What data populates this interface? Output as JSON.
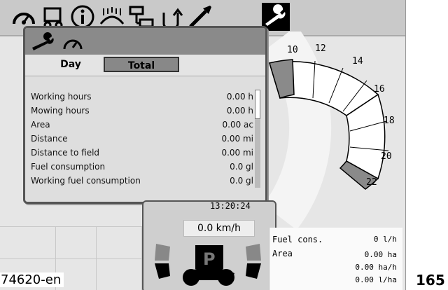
{
  "toolbar": {
    "icons": [
      "speedometer-icon",
      "machine-icon",
      "info-icon",
      "mower-icon",
      "transmission-icon",
      "reverse-icon",
      "wrench-icon",
      "settings-wrench-icon"
    ],
    "active_index": 7
  },
  "gauge": {
    "labels": [
      "10",
      "12",
      "14",
      "16",
      "18",
      "20",
      "22"
    ]
  },
  "counter_panel": {
    "tabs": {
      "day": "Day",
      "total": "Total"
    },
    "active_tab": "Total",
    "rows": [
      {
        "label": "Working hours",
        "value": "0.00 h"
      },
      {
        "label": "Mowing hours",
        "value": "0.00 h"
      },
      {
        "label": "Area",
        "value": "0.00 ac"
      },
      {
        "label": "Distance",
        "value": "0.00 mi"
      },
      {
        "label": "Distance to field",
        "value": "0.00 mi"
      },
      {
        "label": "Fuel consumption",
        "value": "0.0 gl"
      },
      {
        "label": "Working fuel consumption",
        "value": "0.0 gl"
      }
    ]
  },
  "clock": "13:20:24",
  "speed": "0.0 km/h",
  "gear": "P",
  "info_box": {
    "fuel_label": "Fuel cons.",
    "area_label": "Area",
    "values": [
      "0 l/h",
      "0.00 ha",
      "0.00 ha/h",
      "0.00 l/ha"
    ]
  },
  "caption": "74620-en",
  "page_number": "165"
}
